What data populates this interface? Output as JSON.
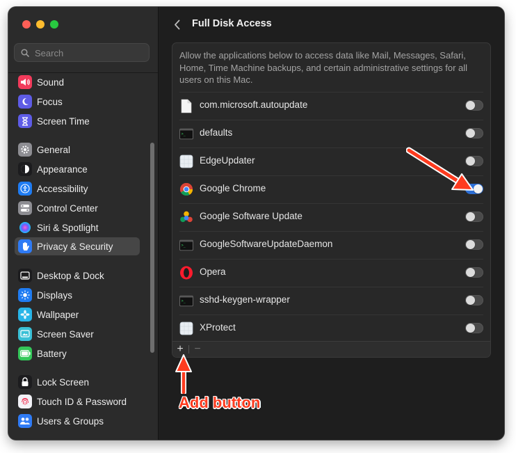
{
  "sidebar": {
    "search_placeholder": "Search",
    "items": [
      {
        "label": "Sound",
        "icon": "speaker-icon",
        "color": "#f23b5b"
      },
      {
        "label": "Focus",
        "icon": "moon-icon",
        "color": "#5e5ce6"
      },
      {
        "label": "Screen Time",
        "icon": "hourglass-icon",
        "color": "#5e5ce6"
      },
      {
        "label": "General",
        "icon": "gear-icon",
        "color": "#8e8e93"
      },
      {
        "label": "Appearance",
        "icon": "appearance-icon",
        "color": "#1c1c1e"
      },
      {
        "label": "Accessibility",
        "icon": "accessibility-icon",
        "color": "#1f7cf2"
      },
      {
        "label": "Control Center",
        "icon": "control-center-icon",
        "color": "#8e8e93"
      },
      {
        "label": "Siri & Spotlight",
        "icon": "siri-icon",
        "color": "#2b2b2b"
      },
      {
        "label": "Privacy & Security",
        "icon": "hand-icon",
        "color": "#2f7bf5"
      },
      {
        "label": "Desktop & Dock",
        "icon": "dock-icon",
        "color": "#1c1c1e"
      },
      {
        "label": "Displays",
        "icon": "sun-icon",
        "color": "#1f7cf2"
      },
      {
        "label": "Wallpaper",
        "icon": "flower-icon",
        "color": "#28b5e8"
      },
      {
        "label": "Screen Saver",
        "icon": "screen-saver-icon",
        "color": "#3ac0d6"
      },
      {
        "label": "Battery",
        "icon": "battery-icon",
        "color": "#34c759"
      },
      {
        "label": "Lock Screen",
        "icon": "lock-icon",
        "color": "#1c1c1e"
      },
      {
        "label": "Touch ID & Password",
        "icon": "fingerprint-icon",
        "color": "#f2f2f7"
      },
      {
        "label": "Users & Groups",
        "icon": "users-icon",
        "color": "#2f7bf5"
      }
    ],
    "selected": "Privacy & Security"
  },
  "main": {
    "title": "Full Disk Access",
    "description": "Allow the applications below to access data like Mail, Messages, Safari, Home, Time Machine backups, and certain administrative settings for all users on this Mac.",
    "apps": [
      {
        "name": "com.microsoft.autoupdate",
        "icon": "document-icon",
        "enabled": false
      },
      {
        "name": "defaults",
        "icon": "terminal-icon",
        "enabled": false
      },
      {
        "name": "EdgeUpdater",
        "icon": "generic-app-icon",
        "enabled": false
      },
      {
        "name": "Google Chrome",
        "icon": "chrome-icon",
        "enabled": true
      },
      {
        "name": "Google Software Update",
        "icon": "google-update-icon",
        "enabled": false
      },
      {
        "name": "GoogleSoftwareUpdateDaemon",
        "icon": "terminal-icon",
        "enabled": false
      },
      {
        "name": "Opera",
        "icon": "opera-icon",
        "enabled": false
      },
      {
        "name": "sshd-keygen-wrapper",
        "icon": "terminal-icon",
        "enabled": false
      },
      {
        "name": "XProtect",
        "icon": "generic-app-icon",
        "enabled": false
      }
    ],
    "add_label": "+",
    "remove_label": "−"
  },
  "annotation": {
    "label": "Add button",
    "color": "#ff3b1f"
  }
}
